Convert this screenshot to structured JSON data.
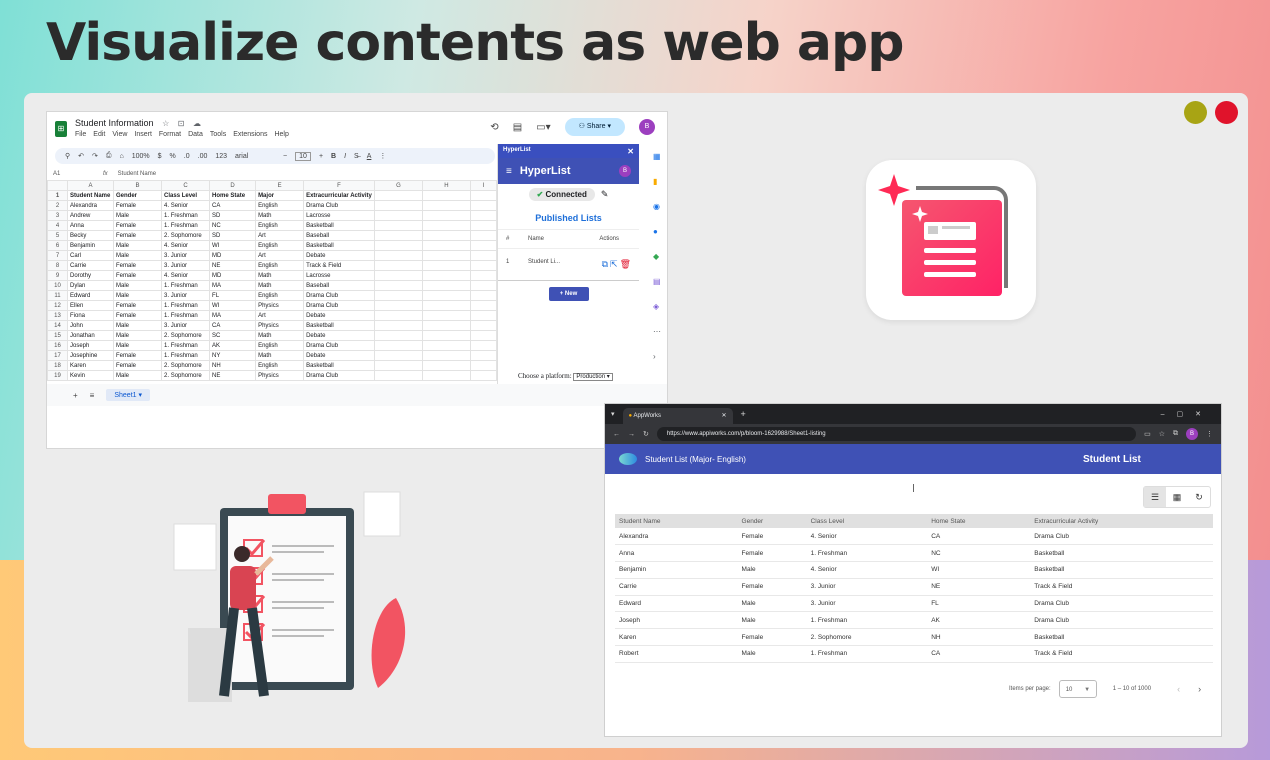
{
  "headline": "Visualize contents as web app",
  "colors": {
    "olive": "#a8a414",
    "red": "#e0132b",
    "indigo": "#3f51b5"
  },
  "sheets": {
    "logo": "⊞",
    "title": "Student Information",
    "menu": [
      "File",
      "Edit",
      "View",
      "Insert",
      "Format",
      "Data",
      "Tools",
      "Extensions",
      "Help"
    ],
    "share_label": "Share",
    "avatar": "B",
    "toolbar": {
      "zoom": "100%",
      "currency": "$",
      "percent": "%",
      "dec1": ".0",
      "dec2": ".00",
      "num": "123",
      "font": "arial",
      "size": "10"
    },
    "cell_ref": "A1",
    "formula": "Student Name",
    "col_letters": [
      "",
      "A",
      "B",
      "C",
      "D",
      "E",
      "F",
      "G",
      "H",
      "I"
    ],
    "header_row": [
      "1",
      "Student Name",
      "Gender",
      "Class Level",
      "Home State",
      "Major",
      "Extracurricular Activity",
      "",
      "",
      ""
    ],
    "rows": [
      [
        "2",
        "Alexandra",
        "Female",
        "4. Senior",
        "CA",
        "English",
        "Drama Club"
      ],
      [
        "3",
        "Andrew",
        "Male",
        "1. Freshman",
        "SD",
        "Math",
        "Lacrosse"
      ],
      [
        "4",
        "Anna",
        "Female",
        "1. Freshman",
        "NC",
        "English",
        "Basketball"
      ],
      [
        "5",
        "Becky",
        "Female",
        "2. Sophomore",
        "SD",
        "Art",
        "Baseball"
      ],
      [
        "6",
        "Benjamin",
        "Male",
        "4. Senior",
        "WI",
        "English",
        "Basketball"
      ],
      [
        "7",
        "Carl",
        "Male",
        "3. Junior",
        "MD",
        "Art",
        "Debate"
      ],
      [
        "8",
        "Carrie",
        "Female",
        "3. Junior",
        "NE",
        "English",
        "Track & Field"
      ],
      [
        "9",
        "Dorothy",
        "Female",
        "4. Senior",
        "MD",
        "Math",
        "Lacrosse"
      ],
      [
        "10",
        "Dylan",
        "Male",
        "1. Freshman",
        "MA",
        "Math",
        "Baseball"
      ],
      [
        "11",
        "Edward",
        "Male",
        "3. Junior",
        "FL",
        "English",
        "Drama Club"
      ],
      [
        "12",
        "Ellen",
        "Female",
        "1. Freshman",
        "WI",
        "Physics",
        "Drama Club"
      ],
      [
        "13",
        "Fiona",
        "Female",
        "1. Freshman",
        "MA",
        "Art",
        "Debate"
      ],
      [
        "14",
        "John",
        "Male",
        "3. Junior",
        "CA",
        "Physics",
        "Basketball"
      ],
      [
        "15",
        "Jonathan",
        "Male",
        "2. Sophomore",
        "SC",
        "Math",
        "Debate"
      ],
      [
        "16",
        "Joseph",
        "Male",
        "1. Freshman",
        "AK",
        "English",
        "Drama Club"
      ],
      [
        "17",
        "Josephine",
        "Female",
        "1. Freshman",
        "NY",
        "Math",
        "Debate"
      ],
      [
        "18",
        "Karen",
        "Female",
        "2. Sophomore",
        "NH",
        "English",
        "Basketball"
      ],
      [
        "19",
        "Kevin",
        "Male",
        "2. Sophomore",
        "NE",
        "Physics",
        "Drama Club"
      ]
    ],
    "sheet_tab": "Sheet1"
  },
  "hyperlist": {
    "panel_title": "HyperList",
    "app_title": "HyperList",
    "avatar": "B",
    "status": "Connected",
    "published_title": "Published Lists",
    "cols": {
      "num": "#",
      "name": "Name",
      "actions": "Actions"
    },
    "row": {
      "num": "1",
      "name": "Student Li..."
    },
    "new_label": "+ New",
    "platform_label": "Choose a platform:",
    "platform_value": "Production"
  },
  "browser": {
    "tab_title": "AppWorks",
    "url": "https://www.appiworks.com/p/bloom-1629988/Sheet1-listing",
    "list_title": "Student List (Major- English)",
    "center_title": "Student List",
    "columns": [
      "Student Name",
      "Gender",
      "Class Level",
      "Home State",
      "Extracurricular Activity"
    ],
    "rows": [
      [
        "Alexandra",
        "Female",
        "4. Senior",
        "CA",
        "Drama Club"
      ],
      [
        "Anna",
        "Female",
        "1. Freshman",
        "NC",
        "Basketball"
      ],
      [
        "Benjamin",
        "Male",
        "4. Senior",
        "WI",
        "Basketball"
      ],
      [
        "Carrie",
        "Female",
        "3. Junior",
        "NE",
        "Track & Field"
      ],
      [
        "Edward",
        "Male",
        "3. Junior",
        "FL",
        "Drama Club"
      ],
      [
        "Joseph",
        "Male",
        "1. Freshman",
        "AK",
        "Drama Club"
      ],
      [
        "Karen",
        "Female",
        "2. Sophomore",
        "NH",
        "Basketball"
      ],
      [
        "Robert",
        "Male",
        "1. Freshman",
        "CA",
        "Track & Field"
      ]
    ],
    "items_per_page_label": "Items per page:",
    "items_per_page": "10",
    "range": "1 – 10 of 1000"
  }
}
